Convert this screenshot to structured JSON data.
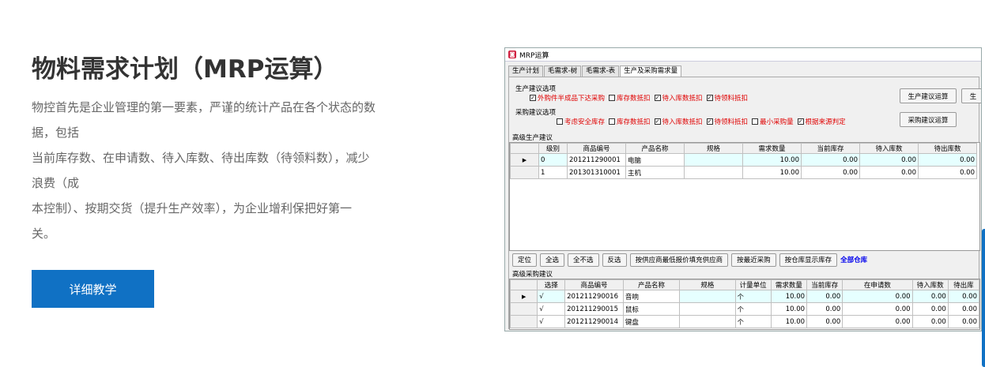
{
  "hero": {
    "title": "物料需求计划（MRP运算）",
    "description_lines": [
      "物控首先是企业管理的第一要素，严谨的统计产品在各个状态的数",
      "据，包括",
      "当前库存数、在申请数、待入库数、待出库数（待领料数），减少",
      "浪费（成",
      "本控制）、按期交货（提升生产效率），为企业增利保把好第一",
      "关。"
    ],
    "cta_label": "详细教学"
  },
  "window": {
    "title": "MRP运算",
    "tabs": [
      "生产计划",
      "毛需求-树",
      "毛需求-表",
      "生产及采购需求量"
    ],
    "active_tab": 3,
    "production_options": {
      "label": "生产建议选项",
      "items": [
        {
          "label": "外购件半成品下达采购",
          "checked": true,
          "red": true
        },
        {
          "label": "库存数抵扣",
          "checked": false,
          "red": true
        },
        {
          "label": "待入库数抵扣",
          "checked": true,
          "red": true
        },
        {
          "label": "待领料抵扣",
          "checked": true,
          "red": true
        }
      ],
      "button": "生产建议运算"
    },
    "purchase_options": {
      "label": "采购建议选项",
      "items": [
        {
          "label": "考虑安全库存",
          "checked": false,
          "red": true
        },
        {
          "label": "库存数抵扣",
          "checked": false,
          "red": true
        },
        {
          "label": "待入库数抵扣",
          "checked": true,
          "red": true
        },
        {
          "label": "待领料抵扣",
          "checked": true,
          "red": true
        },
        {
          "label": "最小采购量",
          "checked": false,
          "red": true
        },
        {
          "label": "根据来源判定",
          "checked": true,
          "red": true
        }
      ],
      "button": "采购建议运算"
    },
    "right_cut_button": "生",
    "production_grid": {
      "label": "高级生产建议",
      "columns": [
        "级别",
        "商品编号",
        "产品名称",
        "规格",
        "需求数量",
        "当前库存",
        "待入库数",
        "待出库数"
      ],
      "rows": [
        [
          "0",
          "201211290001",
          "电脑",
          "",
          "10.00",
          "0.00",
          "0.00",
          "0.00"
        ],
        [
          "1",
          "201301310001",
          "主机",
          "",
          "10.00",
          "0.00",
          "0.00",
          "0.00"
        ]
      ]
    },
    "toolbar": {
      "buttons": [
        "定位",
        "全选",
        "全不选",
        "反选",
        "按供应商最低报价填充供应商",
        "按最近采购",
        "按仓库显示库存"
      ],
      "warehouse_label": "全部仓库"
    },
    "purchase_grid": {
      "label": "高级采购建议",
      "columns": [
        "选择",
        "商品编号",
        "产品名称",
        "规格",
        "计量单位",
        "需求数量",
        "当前库存",
        "在申请数",
        "待入库数",
        "待出库"
      ],
      "rows": [
        [
          "√",
          "201211290016",
          "音响",
          "",
          "个",
          "10.00",
          "0.00",
          "0.00",
          "0.00",
          "0.00"
        ],
        [
          "√",
          "201211290015",
          "鼠标",
          "",
          "个",
          "10.00",
          "0.00",
          "0.00",
          "0.00",
          "0.00"
        ],
        [
          "√",
          "201211290014",
          "键盘",
          "",
          "个",
          "10.00",
          "0.00",
          "0.00",
          "0.00",
          "0.00"
        ]
      ]
    }
  },
  "colors": {
    "accent": "#1071c4",
    "option_red": "#e00000",
    "row_cyan": "#e6ffff",
    "warehouse_blue": "#0000ee"
  }
}
